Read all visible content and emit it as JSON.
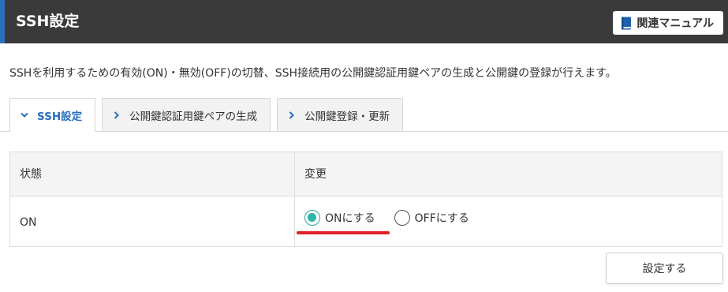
{
  "header": {
    "title": "SSH設定",
    "manual_button": "関連マニュアル",
    "manual_icon": "book-icon"
  },
  "description": "SSHを利用するための有効(ON)・無効(OFF)の切替、SSH接続用の公開鍵認証用鍵ペアの生成と公開鍵の登録が行えます。",
  "tabs": [
    {
      "label": "SSH設定",
      "active": true,
      "icon": "chevron-down-icon"
    },
    {
      "label": "公開鍵認証用鍵ペアの生成",
      "active": false,
      "icon": "chevron-right-icon"
    },
    {
      "label": "公開鍵登録・更新",
      "active": false,
      "icon": "chevron-right-icon"
    }
  ],
  "table": {
    "headers": {
      "status": "状態",
      "change": "変更"
    },
    "status_value": "ON",
    "options": [
      {
        "label": "ONにする",
        "selected": true
      },
      {
        "label": "OFFにする",
        "selected": false
      }
    ]
  },
  "submit_label": "設定する",
  "colors": {
    "header_bg": "#3a3a3a",
    "accent_blue": "#2a6fc0",
    "radio_selected": "#2ab7a9",
    "underline_red": "#e0202a"
  }
}
